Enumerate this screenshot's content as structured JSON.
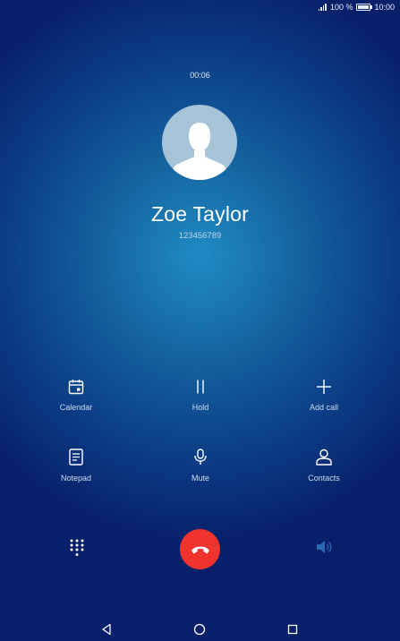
{
  "status_bar": {
    "battery_percent": "100 %",
    "time": "10:00"
  },
  "call": {
    "duration": "00:06",
    "contact_name": "Zoe Taylor",
    "contact_number": "123456789"
  },
  "actions": {
    "calendar": "Calendar",
    "hold": "Hold",
    "add_call": "Add call",
    "notepad": "Notepad",
    "mute": "Mute",
    "contacts": "Contacts"
  },
  "icons": {
    "dialpad": "dialpad-icon",
    "end_call": "end-call-icon",
    "speaker": "speaker-icon",
    "nav_back": "back-icon",
    "nav_home": "home-icon",
    "nav_recents": "recents-icon"
  },
  "colors": {
    "end_call": "#f0332d",
    "background_center": "#1f8cc4",
    "background_edge": "#081f6a"
  }
}
